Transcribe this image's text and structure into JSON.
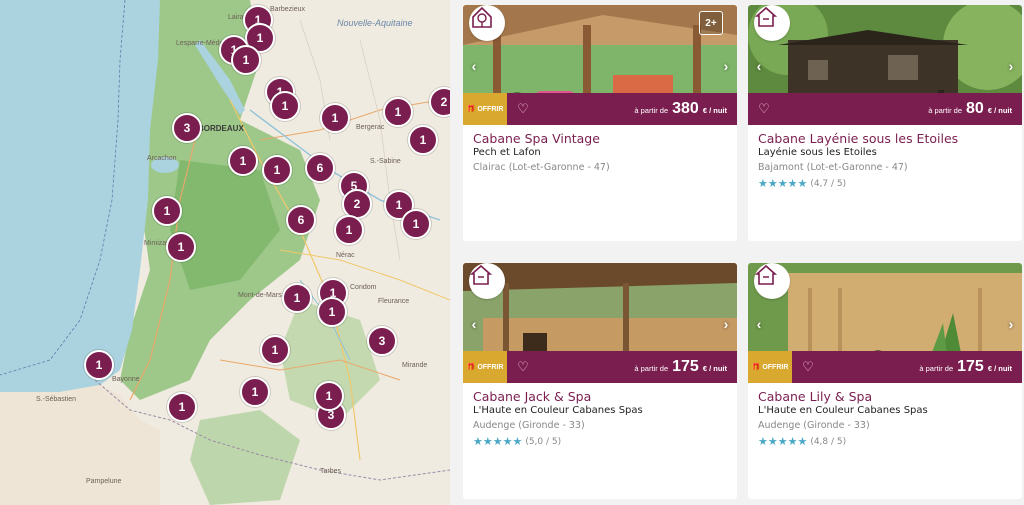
{
  "map": {
    "labels": {
      "nouvelle_aquitaine": "Nouvelle-Aquitaine",
      "barbezieux": "Barbezieux",
      "lairac": "Lairac",
      "lesparre": "Lesparre-Médoc",
      "bordeaux": "BORDEAUX",
      "bergerac": "Bergerac",
      "arcachon": "Arcachon",
      "mimizan": "Mimizan",
      "mont_de_marsan": "Mont-de-Marsan",
      "condom": "Condom",
      "fleurance": "Fleurance",
      "mirande": "Mirande",
      "tarbes": "Tarbes",
      "saint_sebastien": "S.-Sébastien",
      "pamplune": "Pampelune",
      "bayonne": "Bayonne",
      "nerac": "Nérac",
      "sabine": "S.-Sabine"
    },
    "clusters": [
      "1",
      "1",
      "1",
      "1",
      "1",
      "1",
      "1",
      "2",
      "1",
      "3",
      "1",
      "1",
      "1",
      "6",
      "5",
      "2",
      "1",
      "1",
      "6",
      "1",
      "1",
      "1",
      "1",
      "1",
      "1",
      "3",
      "1",
      "1",
      "3",
      "1",
      "1",
      "1"
    ]
  },
  "cards": [
    {
      "type_icon": "treehouse-icon",
      "age_badge": "2+",
      "offer_label": "OFFRIR",
      "price_prefix": "à partir de",
      "price": "380",
      "price_unit": "€ / nuit",
      "title": "Cabane Spa Vintage",
      "host": "Pech et Lafon",
      "location": "Clairac (Lot-et-Garonne - 47)",
      "rating": "",
      "stars": 0
    },
    {
      "type_icon": "house-icon",
      "age_badge": "",
      "offer_label": "",
      "price_prefix": "à partir de",
      "price": "80",
      "price_unit": "€ / nuit",
      "title": "Cabane Layénie sous les Etoiles",
      "host": "Layénie sous les Etoiles",
      "location": "Bajamont (Lot-et-Garonne - 47)",
      "rating": "(4,7 / 5)",
      "stars": 4.7
    },
    {
      "type_icon": "house-icon",
      "age_badge": "",
      "offer_label": "OFFRIR",
      "price_prefix": "à partir de",
      "price": "175",
      "price_unit": "€ / nuit",
      "title": "Cabane Jack & Spa",
      "host": "L'Haute en Couleur Cabanes Spas",
      "location": "Audenge (Gironde - 33)",
      "rating": "(5,0 / 5)",
      "stars": 5
    },
    {
      "type_icon": "house-icon",
      "age_badge": "",
      "offer_label": "OFFRIR",
      "price_prefix": "à partir de",
      "price": "175",
      "price_unit": "€ / nuit",
      "title": "Cabane Lily & Spa",
      "host": "L'Haute en Couleur Cabanes Spas",
      "location": "Audenge (Gironde - 33)",
      "rating": "(4,8 / 5)",
      "stars": 4.8
    }
  ],
  "colors": {
    "accent": "#7a1e4f",
    "offer": "#d9a82e",
    "stars": "#4aa8c6"
  }
}
